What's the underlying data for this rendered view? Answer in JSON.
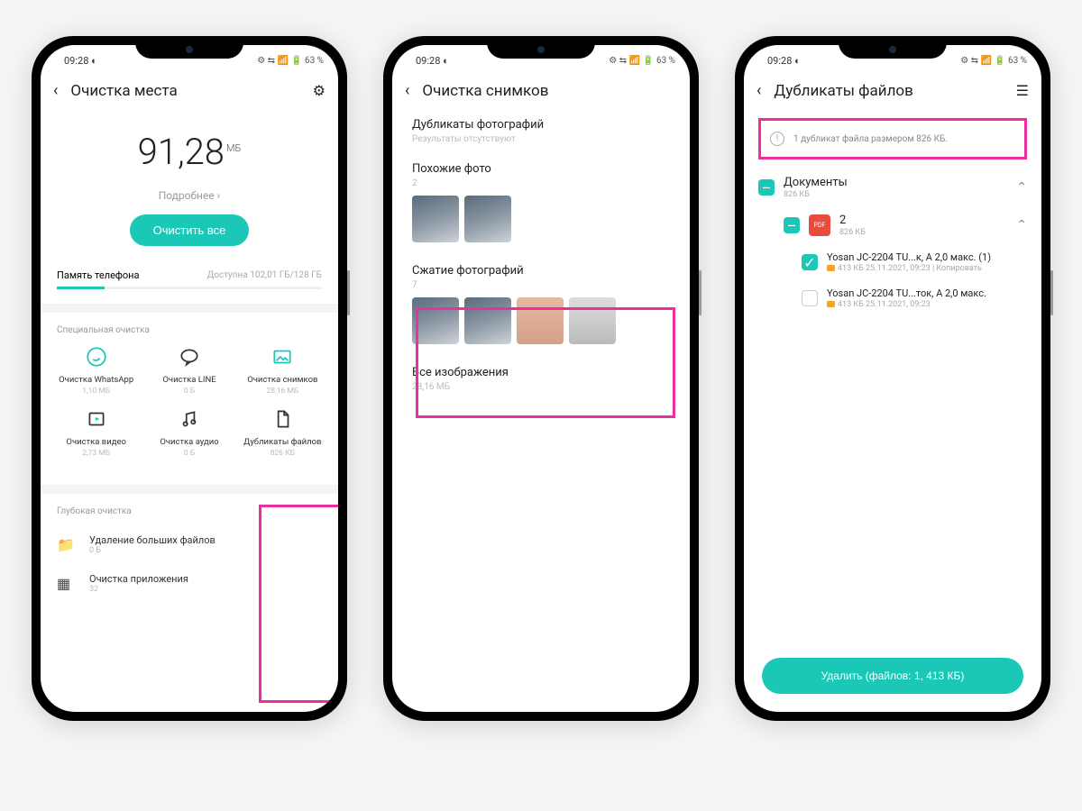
{
  "status": {
    "time": "09:28",
    "battery": "63 %",
    "indicator": "◐"
  },
  "s1": {
    "title": "Очистка места",
    "big": "91,28",
    "unit": "МБ",
    "more": "Подробнее ›",
    "clean": "Очистить все",
    "storage_label": "Память телефона",
    "storage_avail": "Доступна 102,01 ГБ/128 ГБ",
    "special_label": "Специальная очистка",
    "cells": [
      {
        "lbl": "Очистка WhatsApp",
        "sub": "1,10 МБ"
      },
      {
        "lbl": "Очистка LINE",
        "sub": "0 Б"
      },
      {
        "lbl": "Очистка снимков",
        "sub": "28,16 МБ"
      },
      {
        "lbl": "Очистка видео",
        "sub": "2,73 МБ"
      },
      {
        "lbl": "Очистка аудио",
        "sub": "0 Б"
      },
      {
        "lbl": "Дубликаты файлов",
        "sub": "826 КБ"
      }
    ],
    "deep_label": "Глубокая очистка",
    "deep": [
      {
        "t": "Удаление больших файлов",
        "s": "0 Б"
      },
      {
        "t": "Очистка приложения",
        "s": "32"
      }
    ]
  },
  "s2": {
    "title": "Очистка снимков",
    "sec1": "Дубликаты фотографий",
    "sec1sub": "Результаты отсутствуют",
    "sec2": "Похожие фото",
    "sec2sub": "2",
    "sec3": "Сжатие фотографий",
    "sec3sub": "7",
    "sec4": "Все изображения",
    "sec4sub": "28,16 МБ"
  },
  "s3": {
    "title": "Дубликаты файлов",
    "banner": "1 дубликат файла размером 826 КБ.",
    "group": {
      "name": "Документы",
      "size": "826 КБ"
    },
    "subgroup": {
      "name": "2",
      "size": "826 КБ"
    },
    "files": [
      {
        "name": "Yosan JC-2204 TU...к, A 2,0 макс. (1)",
        "meta": "413 КБ 25.11.2021, 09:23  | Копировать",
        "checked": true
      },
      {
        "name": "Yosan JC-2204 TU...ток, A 2,0 макс.",
        "meta": "413 КБ 25.11.2021, 09:23",
        "checked": false
      }
    ],
    "delete": "Удалить (файлов: 1, 413 КБ)"
  }
}
